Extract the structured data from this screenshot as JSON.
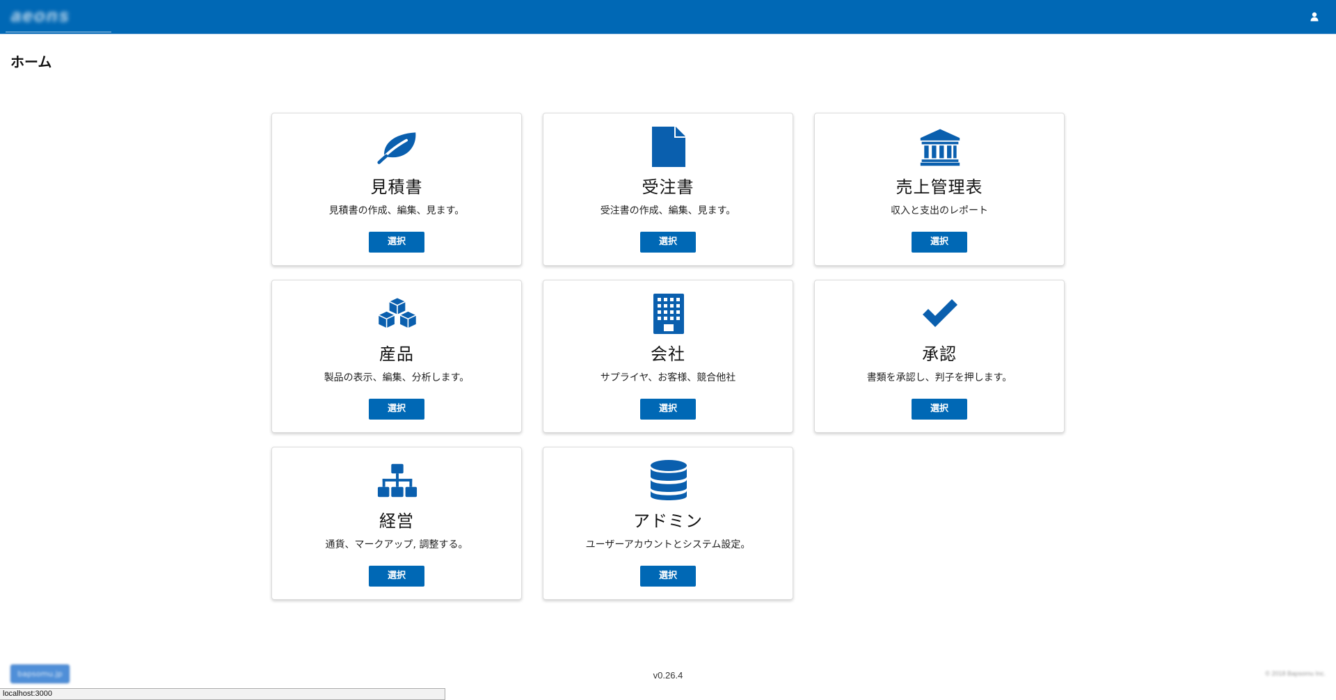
{
  "app": {
    "logo_text": "aeons",
    "page_title": "ホーム"
  },
  "cards": [
    {
      "title": "見積書",
      "description": "見積書の作成、編集、見ます。",
      "button": "選択",
      "icon": "leaf-icon"
    },
    {
      "title": "受注書",
      "description": "受注書の作成、編集、見ます。",
      "button": "選択",
      "icon": "file-icon"
    },
    {
      "title": "売上管理表",
      "description": "収入と支出のレポート",
      "button": "選択",
      "icon": "bank-icon"
    },
    {
      "title": "産品",
      "description": "製品の表示、編集、分析します。",
      "button": "選択",
      "icon": "cubes-icon"
    },
    {
      "title": "会社",
      "description": "サプライヤ、お客様、競合他社",
      "button": "選択",
      "icon": "building-icon"
    },
    {
      "title": "承認",
      "description": "書類を承認し、判子を押します。",
      "button": "選択",
      "icon": "check-icon"
    },
    {
      "title": "経営",
      "description": "通貨、マークアップ, 調整する。",
      "button": "選択",
      "icon": "sitemap-icon"
    },
    {
      "title": "アドミン",
      "description": "ユーザーアカウントとシステム設定。",
      "button": "選択",
      "icon": "database-icon"
    }
  ],
  "footer": {
    "left_button": "bapsomu.jp",
    "version": "v0.26.4",
    "copyright": "© 2018 Bapsomu Inc."
  },
  "statusbar": {
    "url": "localhost:3000"
  },
  "colors": {
    "brand": "#0068b5",
    "icon": "#0a5fae"
  }
}
